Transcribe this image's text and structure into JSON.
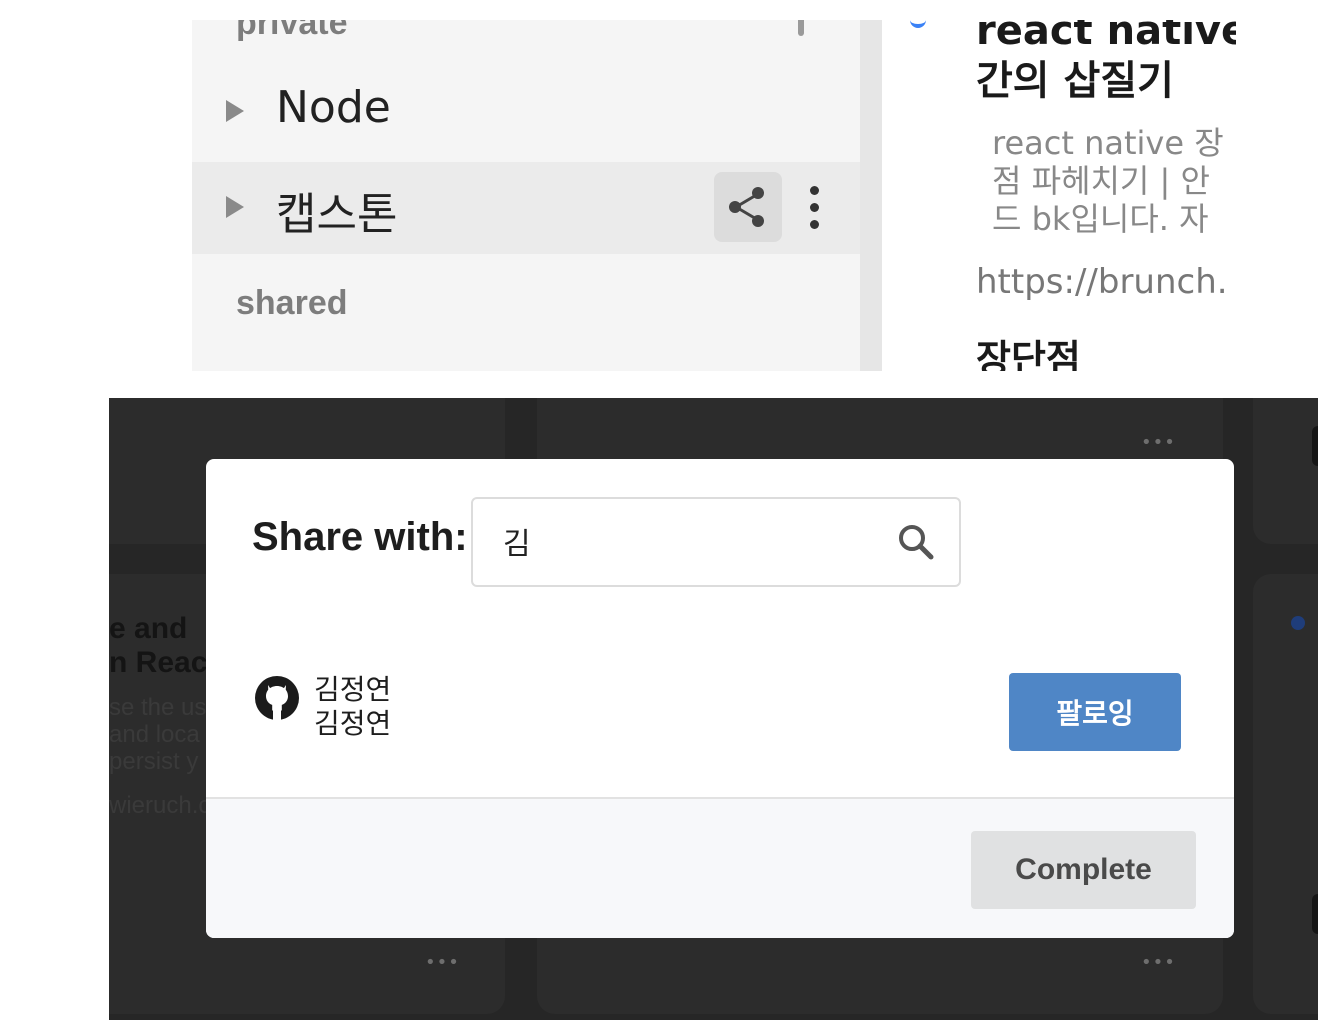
{
  "sidebar": {
    "private_label": "private",
    "items": [
      {
        "label": "Node"
      },
      {
        "label": "캡스톤"
      }
    ],
    "shared_label": "shared"
  },
  "document": {
    "title_line1": "react native",
    "title_line2": "간의 삽질기",
    "excerpt_line1": "react native 장",
    "excerpt_line2": "점 파헤치기 | 안",
    "excerpt_line3": "드 bk입니다. 자",
    "url": "https://brunch.",
    "heading": "장단점"
  },
  "background_card": {
    "title_line1": "e and",
    "title_line2": "n React",
    "sub_line1": "se the us",
    "sub_line2": "and loca",
    "sub_line3": "persist y",
    "url": "wieruch.c",
    "dots": "•••"
  },
  "modal": {
    "title": "Share with:",
    "search_value": "김",
    "results": [
      {
        "name": "김정연",
        "login": "김정연",
        "button": "팔로잉"
      }
    ],
    "complete_label": "Complete"
  },
  "colors": {
    "follow_button": "#4f86c6",
    "overlay": "#262626",
    "accent_bullet": "#3b82f6"
  }
}
